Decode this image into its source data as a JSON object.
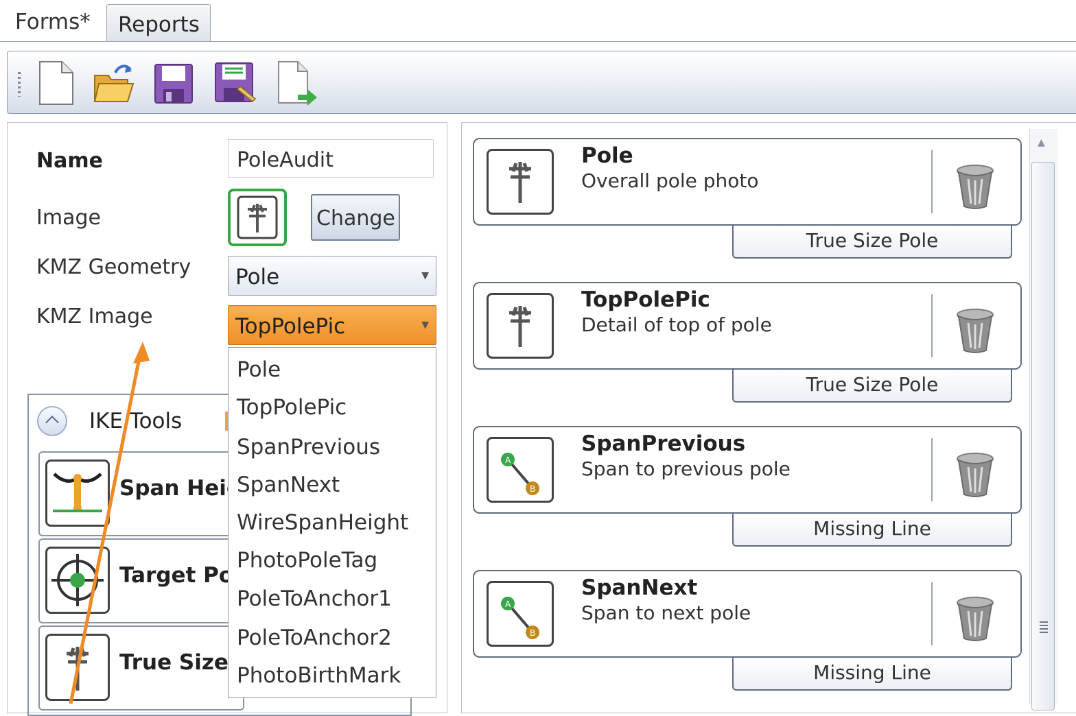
{
  "tabs": [
    {
      "label": "Forms*"
    },
    {
      "label": "Reports"
    }
  ],
  "toolbar": {
    "icons": [
      "new-document-icon",
      "open-folder-icon",
      "save-icon",
      "save-as-icon",
      "export-icon"
    ]
  },
  "form": {
    "name_label": "Name",
    "name_value": "PoleAudit",
    "image_label": "Image",
    "change_label": "Change",
    "kmz_geometry_label": "KMZ Geometry",
    "kmz_geometry_value": "Pole",
    "kmz_image_label": "KMZ Image",
    "kmz_image_value": "TopPolePic"
  },
  "dropdown_options": [
    "Pole",
    "TopPolePic",
    "SpanPrevious",
    "SpanNext",
    "WireSpanHeight",
    "PhotoPoleTag",
    "PoleToAnchor1",
    "PoleToAnchor2",
    "PhotoBirthMark"
  ],
  "ike_tools": {
    "title": "IKE Tools",
    "tools": [
      {
        "label": "Span Heig",
        "icon": "span-height-icon"
      },
      {
        "label": "Target Po",
        "icon": "target-icon"
      },
      {
        "label": "True Size",
        "icon": "true-size-pole-icon"
      }
    ]
  },
  "cards": [
    {
      "title": "Pole",
      "description": "Overall pole photo",
      "tag": "True Size Pole",
      "icon": "pole-icon"
    },
    {
      "title": "TopPolePic",
      "description": "Detail of top of pole",
      "tag": "True Size Pole",
      "icon": "pole-icon"
    },
    {
      "title": "SpanPrevious",
      "description": "Span to previous pole",
      "tag": "Missing Line",
      "icon": "span-icon"
    },
    {
      "title": "SpanNext",
      "description": "Span to next pole",
      "tag": "Missing Line",
      "icon": "span-icon"
    }
  ],
  "colors": {
    "accent_orange": "#f0912a",
    "image_border_green": "#3aa64a",
    "annotation_arrow": "#f08a24"
  }
}
